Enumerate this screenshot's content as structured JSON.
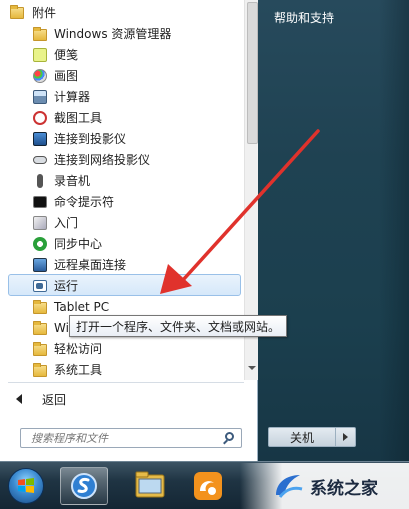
{
  "right_panel": {
    "help_link": "帮助和支持"
  },
  "menu": {
    "folder_label": "附件",
    "items": [
      {
        "label": "Windows 资源管理器",
        "icon": "windows-explorer-icon"
      },
      {
        "label": "便笺",
        "icon": "sticky-notes-icon"
      },
      {
        "label": "画图",
        "icon": "paint-icon"
      },
      {
        "label": "计算器",
        "icon": "calculator-icon"
      },
      {
        "label": "截图工具",
        "icon": "snipping-tool-icon"
      },
      {
        "label": "连接到投影仪",
        "icon": "projector-icon"
      },
      {
        "label": "连接到网络投影仪",
        "icon": "network-projector-icon"
      },
      {
        "label": "录音机",
        "icon": "microphone-icon"
      },
      {
        "label": "命令提示符",
        "icon": "command-prompt-icon"
      },
      {
        "label": "入门",
        "icon": "getting-started-icon"
      },
      {
        "label": "同步中心",
        "icon": "sync-center-icon"
      },
      {
        "label": "远程桌面连接",
        "icon": "remote-desktop-icon"
      },
      {
        "label": "运行",
        "icon": "run-icon"
      },
      {
        "label": "Tablet PC",
        "icon": "folder-icon"
      },
      {
        "label": "Wi",
        "icon": "folder-icon"
      },
      {
        "label": "轻松访问",
        "icon": "folder-icon"
      },
      {
        "label": "系统工具",
        "icon": "folder-icon"
      }
    ],
    "tooltip": "打开一个程序、文件夹、文档或网站。",
    "back_label": "返回"
  },
  "search": {
    "placeholder": "搜索程序和文件"
  },
  "shutdown": {
    "label": "关机"
  },
  "watermark": {
    "text": "系统之家"
  },
  "colors": {
    "accent": "#e0322c",
    "highlight": "#d6e8fa",
    "glass": "#1f4252"
  }
}
